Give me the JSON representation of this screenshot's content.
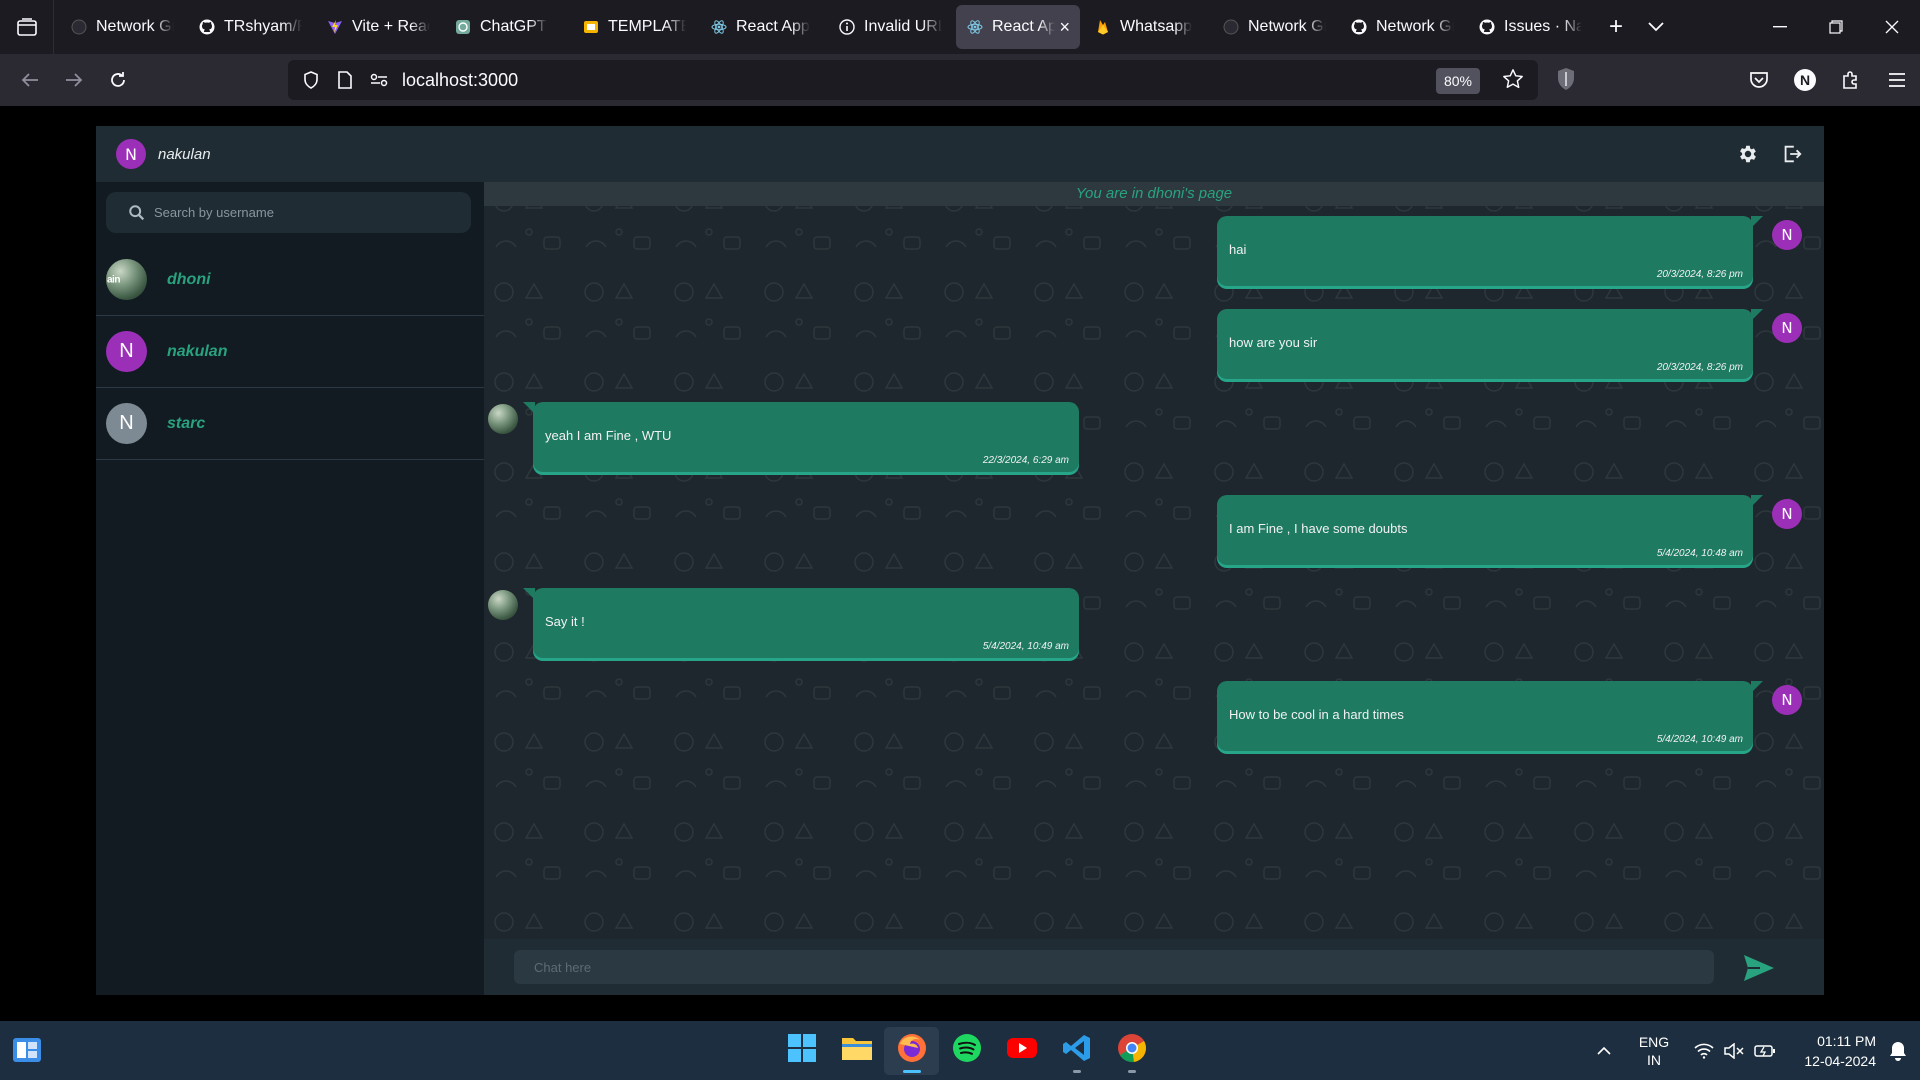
{
  "browser": {
    "tabs": [
      {
        "label": "Network Gr",
        "icon": "network-tab-icon",
        "active": false
      },
      {
        "label": "TRshyam/R",
        "icon": "github-icon",
        "active": false
      },
      {
        "label": "Vite + Reac",
        "icon": "vite-icon",
        "active": false
      },
      {
        "label": "ChatGPT",
        "icon": "chatgpt-icon",
        "active": false
      },
      {
        "label": "TEMPLATE",
        "icon": "slides-icon",
        "active": false
      },
      {
        "label": "React App",
        "icon": "react-icon",
        "active": false
      },
      {
        "label": "Invalid URL",
        "icon": "info-icon",
        "active": false
      },
      {
        "label": "React Ap",
        "icon": "react-icon",
        "active": true
      },
      {
        "label": "Whatsapp",
        "icon": "firebase-icon",
        "active": false
      },
      {
        "label": "Network Gr",
        "icon": "network-tab-icon",
        "active": false
      },
      {
        "label": "Network Gr",
        "icon": "github-icon",
        "active": false
      },
      {
        "label": "Issues · Nak",
        "icon": "github-icon",
        "active": false
      }
    ],
    "url": "localhost:3000",
    "zoom": "80%",
    "profile_initial": "N"
  },
  "app": {
    "current_user": {
      "initial": "N",
      "name": "nakulan"
    },
    "search_placeholder": "Search by username",
    "contacts": [
      {
        "name": "dhoni",
        "avatar": "photo",
        "photo_text": "ain"
      },
      {
        "name": "nakulan",
        "avatar": "initial",
        "initial": "N",
        "color": "#9c2fb7"
      },
      {
        "name": "starc",
        "avatar": "initial",
        "initial": "N",
        "color": "#7d8a93"
      }
    ],
    "chat_banner": "You are in dhoni's page",
    "messages": [
      {
        "dir": "out",
        "text": "hai",
        "time": "20/3/2024, 8:26 pm",
        "avatar_initial": "N"
      },
      {
        "dir": "out",
        "text": "how are you sir",
        "time": "20/3/2024, 8:26 pm",
        "avatar_initial": "N"
      },
      {
        "dir": "in",
        "text": "yeah I am Fine , WTU",
        "time": "22/3/2024, 6:29 am"
      },
      {
        "dir": "out",
        "text": "I am Fine , I have some doubts",
        "time": "5/4/2024, 10:48 am",
        "avatar_initial": "N"
      },
      {
        "dir": "in",
        "text": "Say it !",
        "time": "5/4/2024, 10:49 am"
      },
      {
        "dir": "out",
        "text": "How to be cool in a hard times",
        "time": "5/4/2024, 10:49 am",
        "avatar_initial": "N"
      }
    ],
    "composer_placeholder": "Chat here",
    "accent_color": "#29a37f",
    "bubble_color": "#1f7a62"
  },
  "taskbar": {
    "apps": [
      {
        "name": "windows-start-icon",
        "active": false
      },
      {
        "name": "file-explorer-icon",
        "active": false
      },
      {
        "name": "firefox-icon",
        "active": true
      },
      {
        "name": "spotify-icon",
        "active": false
      },
      {
        "name": "youtube-icon",
        "active": false
      },
      {
        "name": "vscode-icon",
        "active": false
      },
      {
        "name": "chrome-icon",
        "active": false
      }
    ],
    "lang_line1": "ENG",
    "lang_line2": "IN",
    "time": "01:11 PM",
    "date": "12-04-2024"
  }
}
